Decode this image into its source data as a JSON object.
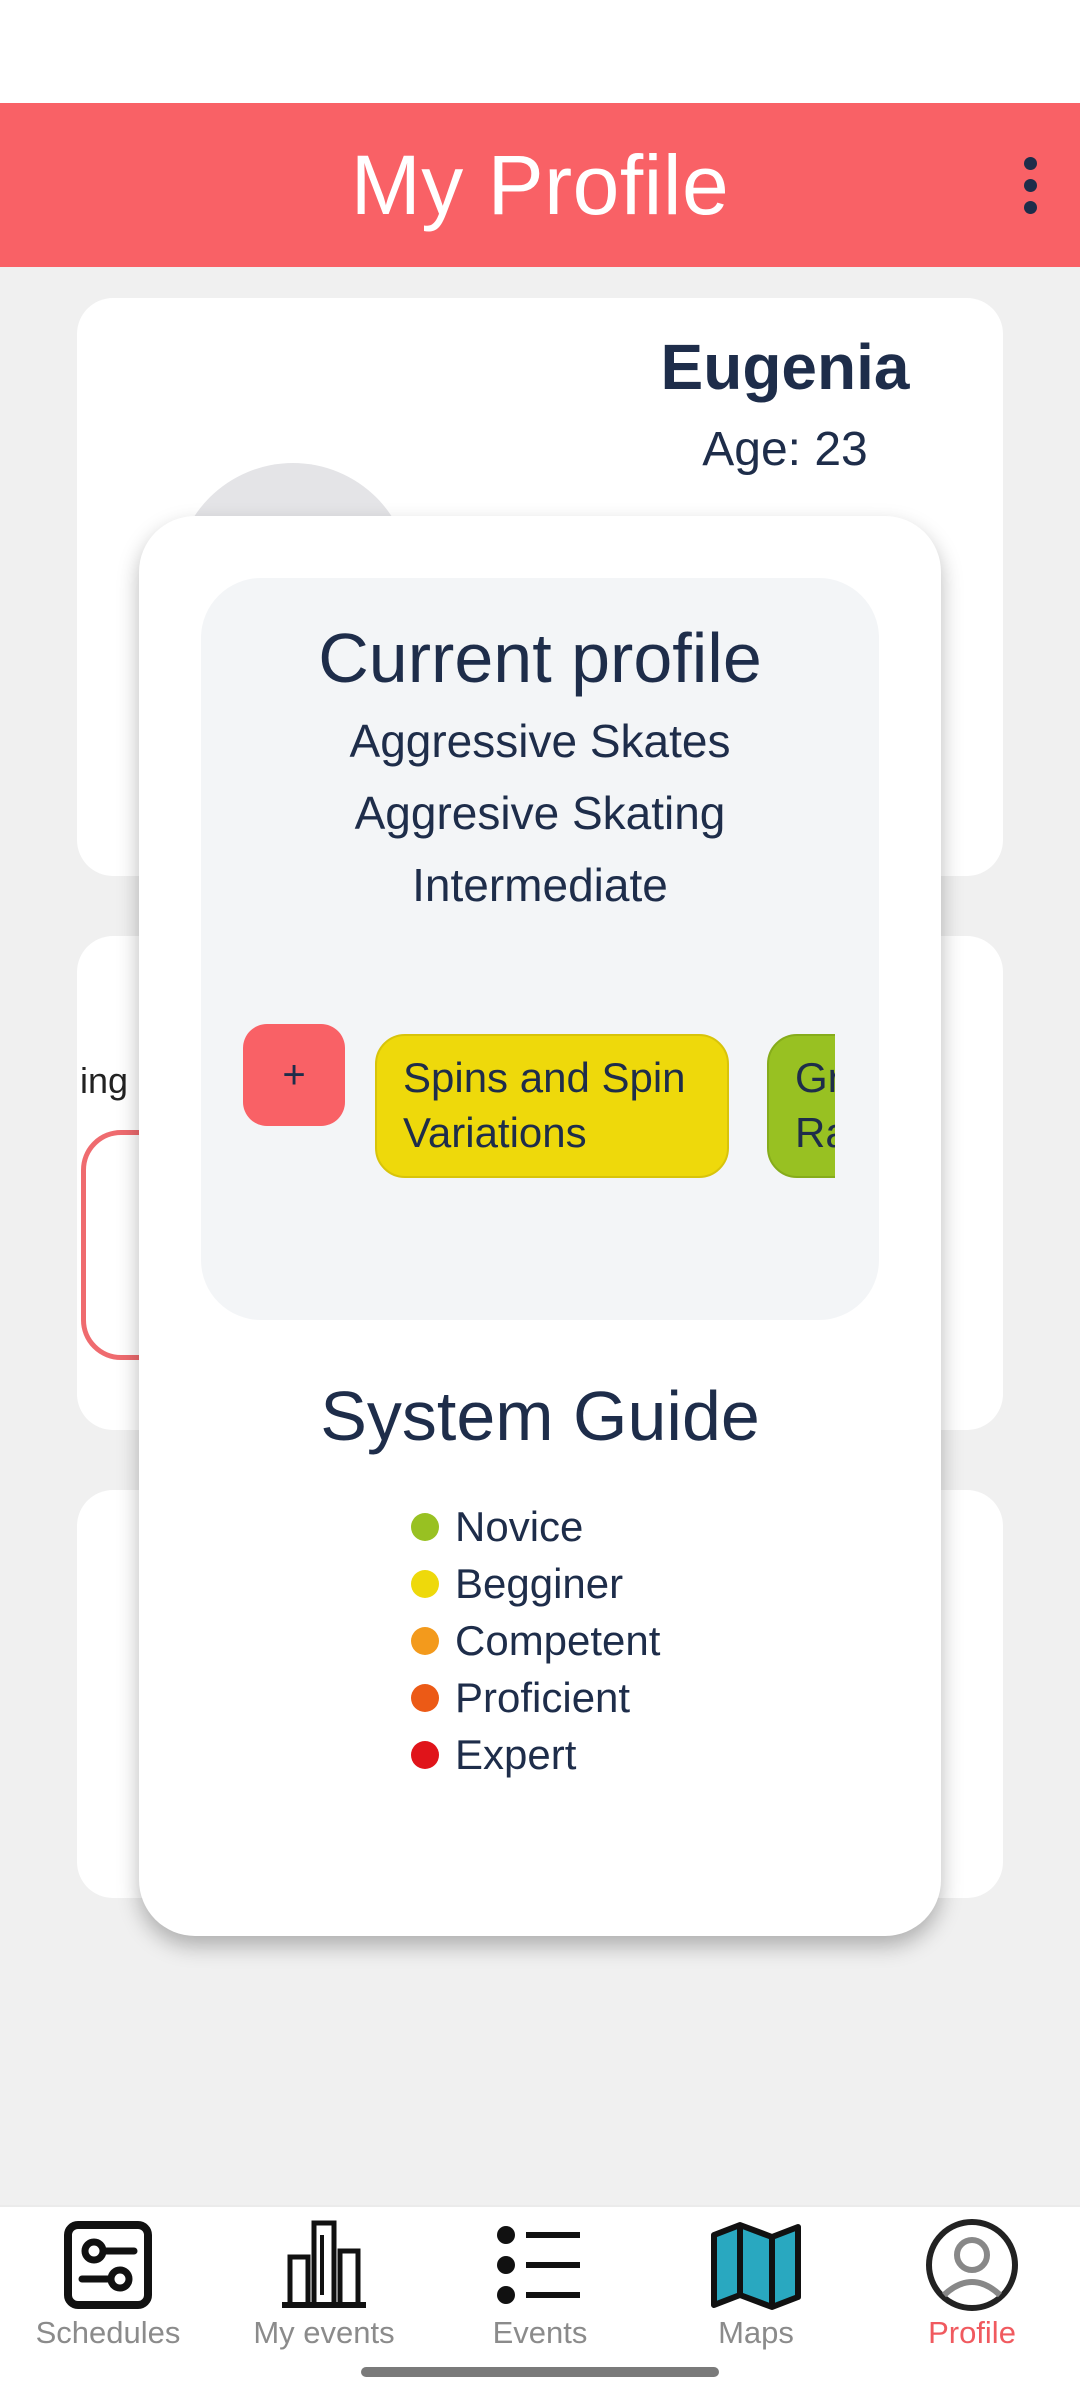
{
  "header": {
    "title": "My Profile",
    "menu_icon": "more-vertical-icon"
  },
  "profile": {
    "name": "Eugenia",
    "age_label": "Age: 23"
  },
  "background": {
    "partial_label": "ing"
  },
  "modal": {
    "current_profile": {
      "title": "Current profile",
      "lines": [
        "Aggressive Skates",
        "Aggresive Skating",
        "Intermediate"
      ]
    },
    "add_button_label": "+",
    "chips": [
      {
        "label_line1": "Spins and Spin",
        "label_line2": "Variations",
        "color": "#eed90b"
      },
      {
        "label_line1": "Gr",
        "label_line2": "Ra",
        "color": "#98c122"
      }
    ],
    "system_guide": {
      "title": "System Guide",
      "levels": [
        {
          "label": "Novice",
          "color": "#98c122"
        },
        {
          "label": "Begginer",
          "color": "#eed90b"
        },
        {
          "label": "Competent",
          "color": "#f39a1c"
        },
        {
          "label": "Proficient",
          "color": "#ec5a16"
        },
        {
          "label": "Expert",
          "color": "#e0141a"
        }
      ]
    }
  },
  "nav": {
    "items": [
      {
        "label": "Schedules",
        "icon": "sliders-icon"
      },
      {
        "label": "My events",
        "icon": "buildings-icon"
      },
      {
        "label": "Events",
        "icon": "list-icon"
      },
      {
        "label": "Maps",
        "icon": "map-icon"
      },
      {
        "label": "Profile",
        "icon": "user-circle-icon"
      }
    ],
    "active": "Profile"
  },
  "colors": {
    "accent": "#f96166",
    "text": "#1e2d4a",
    "active_nav": "#f05a5f"
  }
}
